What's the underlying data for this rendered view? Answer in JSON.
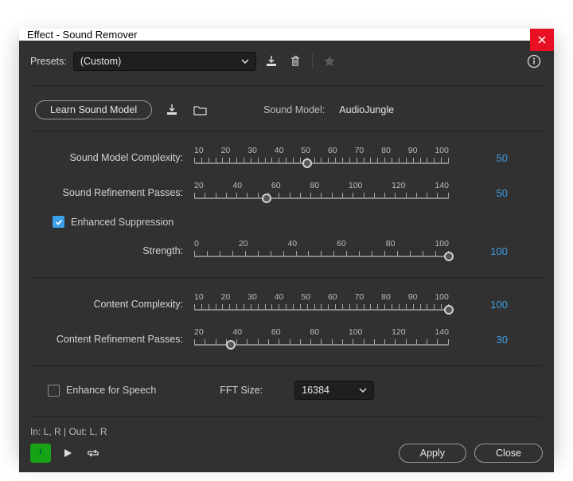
{
  "window": {
    "title": "Effect - Sound Remover"
  },
  "presets": {
    "label": "Presets:",
    "value": "(Custom)"
  },
  "learn": {
    "button": "Learn Sound Model",
    "sound_model_label": "Sound Model:",
    "sound_model_value": "AudioJungle"
  },
  "sliders": {
    "sound_model_complexity": {
      "label": "Sound Model Complexity:",
      "ticks": [
        "10",
        "20",
        "30",
        "40",
        "50",
        "60",
        "70",
        "80",
        "90",
        "100"
      ],
      "value": "50",
      "min": 10,
      "max": 100,
      "current": 50
    },
    "sound_refinement_passes": {
      "label": "Sound Refinement Passes:",
      "ticks": [
        "20",
        "40",
        "60",
        "80",
        "100",
        "120",
        "140"
      ],
      "value": "50",
      "min": 10,
      "max": 150,
      "current": 50
    },
    "enhanced_suppression": {
      "label": "Enhanced Suppression",
      "checked": true
    },
    "strength": {
      "label": "Strength:",
      "ticks": [
        "0",
        "20",
        "40",
        "60",
        "80",
        "100"
      ],
      "value": "100",
      "min": 0,
      "max": 100,
      "current": 100
    },
    "content_complexity": {
      "label": "Content Complexity:",
      "ticks": [
        "10",
        "20",
        "30",
        "40",
        "50",
        "60",
        "70",
        "80",
        "90",
        "100"
      ],
      "value": "100",
      "min": 10,
      "max": 100,
      "current": 100
    },
    "content_refinement_passes": {
      "label": "Content Refinement Passes:",
      "ticks": [
        "20",
        "40",
        "60",
        "80",
        "100",
        "120",
        "140"
      ],
      "value": "30",
      "min": 10,
      "max": 150,
      "current": 30
    }
  },
  "enhance_for_speech": {
    "label": "Enhance for Speech",
    "checked": false
  },
  "fft": {
    "label": "FFT Size:",
    "value": "16384"
  },
  "io": {
    "text": "In: L, R | Out: L, R"
  },
  "footer": {
    "apply": "Apply",
    "close": "Close"
  },
  "icons": {
    "save_preset": "save-preset-icon",
    "delete_preset": "trash-icon",
    "favorite": "star-icon",
    "info": "info-icon",
    "save_model": "save-model-icon",
    "open_model": "folder-icon",
    "power": "power-icon",
    "play": "play-icon",
    "loop": "loop-icon"
  }
}
